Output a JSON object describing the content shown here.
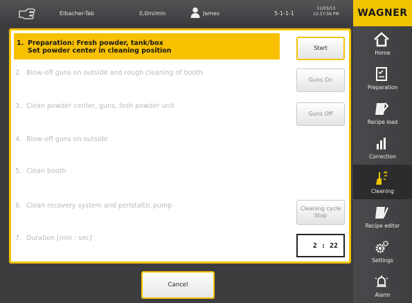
{
  "topbar": {
    "station": "Eibacher-Tab",
    "speed": "0,0m/min",
    "user": "James",
    "code": "5-1-1-1",
    "date": "11/05/13",
    "time": "12:37:59 PM",
    "hand_icon": "hand-icon",
    "user_icon": "user-icon"
  },
  "logo": {
    "text": "WAGNER",
    "color": "#f2c400"
  },
  "steps": [
    {
      "num": "1.",
      "line1": "Preparation: Fresh powder, tank/box",
      "line2": "Set powder center in cleaning position"
    },
    {
      "num": "2.",
      "text": "Blow-off guns on outside and rough cleaning of booth"
    },
    {
      "num": "3.",
      "text": "Clean powder center, guns, fesh powder unit"
    },
    {
      "num": "4.",
      "text": "Blow-off guns on outside"
    },
    {
      "num": "5.",
      "text": "Clean booth"
    },
    {
      "num": "6.",
      "text": "Clean recovery system and peristaltic pump"
    },
    {
      "num": "7.",
      "text": "Duration [min : sec]"
    }
  ],
  "buttons": {
    "start": "Start",
    "guns_on": "Guns On",
    "guns_off": "Guns Off",
    "cycle_stop_1": "Cleaning cycle",
    "cycle_stop_2": "Stop",
    "cancel": "Cancel"
  },
  "duration": "2 : 22",
  "sidebar": {
    "items": [
      {
        "label": "Home",
        "icon": "home-icon"
      },
      {
        "label": "Preparation",
        "icon": "checklist-icon"
      },
      {
        "label": "Recipe load",
        "icon": "recipe-load-icon"
      },
      {
        "label": "Correction",
        "icon": "bar-chart-icon"
      },
      {
        "label": "Cleaning",
        "icon": "cleaning-icon",
        "active": true
      },
      {
        "label": "Recipe editor",
        "icon": "recipe-editor-icon"
      },
      {
        "label": "Settings",
        "icon": "gears-icon"
      },
      {
        "label": "Alarm",
        "icon": "alarm-icon"
      }
    ]
  },
  "colors": {
    "accent": "#f2c400",
    "highlight": "#f7c000",
    "sidebar": "#444447"
  }
}
